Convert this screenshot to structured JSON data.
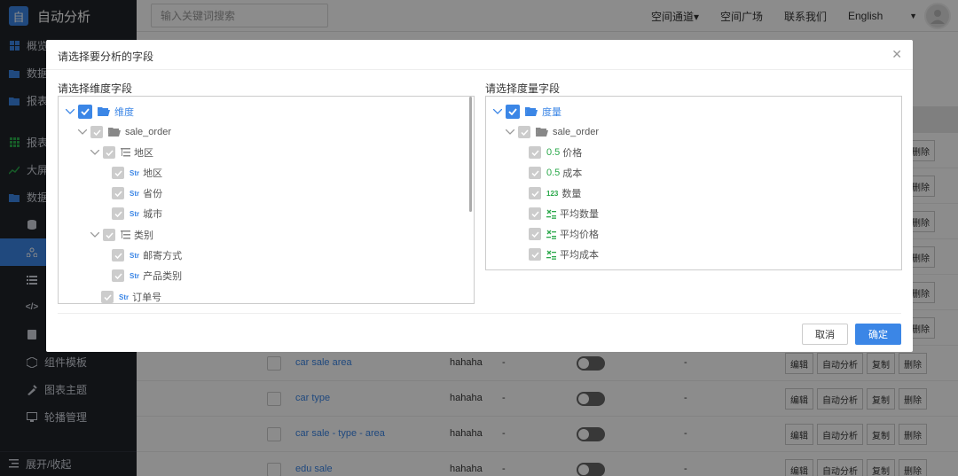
{
  "app": {
    "logo_char": "自",
    "title": "自动分析"
  },
  "sidebar": {
    "items": [
      {
        "label": "概览",
        "icon": "grid-icon"
      },
      {
        "label": "数据",
        "icon": "folder-icon"
      },
      {
        "label": "报表",
        "icon": "folder-icon"
      },
      {
        "label": "报表",
        "icon": "grid-icon"
      },
      {
        "label": "大屏",
        "icon": "chart-icon"
      },
      {
        "label": "数据",
        "icon": "folder-icon"
      }
    ],
    "sub_items": [
      {
        "label": "",
        "icon": "database-icon"
      },
      {
        "label": "",
        "icon": "share-icon",
        "active": true
      },
      {
        "label": "",
        "icon": "list-icon"
      },
      {
        "label": "",
        "icon": "code-icon"
      },
      {
        "label": "",
        "icon": "doc-icon"
      },
      {
        "label": "组件模板",
        "icon": "template-icon"
      },
      {
        "label": "图表主题",
        "icon": "theme-icon"
      },
      {
        "label": "轮播管理",
        "icon": "monitor-icon"
      }
    ],
    "footer": "展开/收起"
  },
  "header": {
    "search_placeholder": "输入关键词搜索",
    "menu": [
      "空间通道▾",
      "空间广场",
      "联系我们"
    ],
    "language": "English"
  },
  "table": {
    "rows": [
      {
        "name": "car sale area",
        "creator": "hahaha",
        "col3": "-",
        "col5": "-"
      },
      {
        "name": "car type",
        "creator": "hahaha",
        "col3": "-",
        "col5": "-"
      },
      {
        "name": "car sale - type - area",
        "creator": "hahaha",
        "col3": "-",
        "col5": "-"
      },
      {
        "name": "edu sale",
        "creator": "hahaha",
        "col3": "-",
        "col5": "-"
      }
    ],
    "actions": [
      "编辑",
      "自动分析",
      "复制",
      "删除"
    ],
    "partial_delete_label": "删除"
  },
  "dialog": {
    "title": "请选择要分析的字段",
    "dimension_label": "请选择维度字段",
    "measure_label": "请选择度量字段",
    "dimension_tree": {
      "root": "维度",
      "source": "sale_order",
      "groups": [
        {
          "name": "地区",
          "fields": [
            "地区",
            "省份",
            "城市"
          ]
        },
        {
          "name": "类别",
          "fields": [
            "邮寄方式",
            "产品类别"
          ]
        }
      ],
      "extra_field": "订单号",
      "field_type_tag": "Str"
    },
    "measure_tree": {
      "root": "度量",
      "source": "sale_order",
      "fields": [
        {
          "tag": "0.5",
          "name": "价格"
        },
        {
          "tag": "0.5",
          "name": "成本"
        },
        {
          "tag": "123",
          "name": "数量"
        },
        {
          "tag": "calc",
          "name": "平均数量"
        },
        {
          "tag": "calc",
          "name": "平均价格"
        },
        {
          "tag": "calc",
          "name": "平均成本"
        }
      ]
    },
    "cancel_label": "取消",
    "ok_label": "确定"
  },
  "colors": {
    "accent": "#3b86e6",
    "sidebar_bg": "#1f2329",
    "green": "#2aa84a"
  }
}
